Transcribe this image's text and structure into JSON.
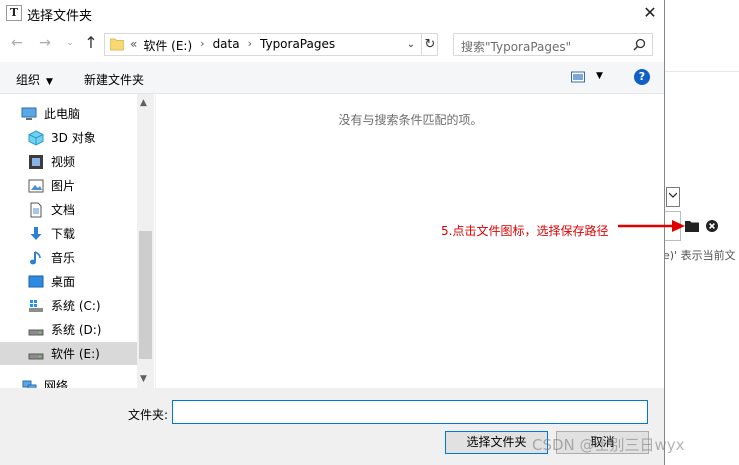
{
  "dialog": {
    "title": "选择文件夹",
    "app_icon_letter": "T",
    "close_glyph": "✕"
  },
  "navigation": {
    "back_glyph": "←",
    "forward_glyph": "→",
    "recent_glyph": "⌄",
    "up_glyph": "↑",
    "breadcrumb_overflow": "«",
    "breadcrumbs": [
      "软件 (E:)",
      "data",
      "TyporaPages"
    ],
    "breadcrumb_separator": "›",
    "dropdown_glyph": "⌄",
    "refresh_glyph": "↻",
    "search_placeholder": "搜索\"TyporaPages\""
  },
  "toolbar": {
    "organize_label": "组织",
    "organize_caret": "▼",
    "new_folder_label": "新建文件夹",
    "view_caret": "▼",
    "help_label": "?"
  },
  "nav_tree": {
    "items": [
      {
        "label": "此电脑",
        "icon": "computer-icon"
      },
      {
        "label": "3D 对象",
        "icon": "3d-objects-icon"
      },
      {
        "label": "视频",
        "icon": "video-icon"
      },
      {
        "label": "图片",
        "icon": "pictures-icon"
      },
      {
        "label": "文档",
        "icon": "documents-icon"
      },
      {
        "label": "下载",
        "icon": "download-icon"
      },
      {
        "label": "音乐",
        "icon": "music-icon"
      },
      {
        "label": "桌面",
        "icon": "desktop-icon"
      },
      {
        "label": "系统 (C:)",
        "icon": "system-drive-icon"
      },
      {
        "label": "系统 (D:)",
        "icon": "drive-icon"
      },
      {
        "label": "软件 (E:)",
        "icon": "drive-icon",
        "selected": true
      },
      {
        "label": "网络",
        "icon": "network-icon"
      }
    ],
    "scroll_up_glyph": "▲",
    "scroll_down_glyph": "▼"
  },
  "content": {
    "empty_message": "没有与搜索条件匹配的项。"
  },
  "footer": {
    "folder_label": "文件夹:",
    "folder_value": "",
    "select_button": "选择文件夹",
    "cancel_button": "取消"
  },
  "background_app": {
    "hint_text": "e)' 表示当前文"
  },
  "annotation": {
    "text": "5.点击文件图标，选择保存路径",
    "color": "#e00000"
  },
  "watermark": {
    "text": "CSDN @士别三日wyx"
  },
  "colors": {
    "accent_blue": "#0078d7",
    "help_blue": "#1160c5",
    "selected_bg": "#d9d9d9"
  }
}
